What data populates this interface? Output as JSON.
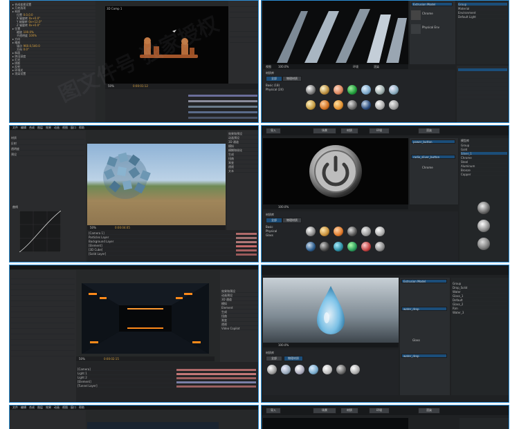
{
  "tiles": {
    "t1": {
      "title": "合成效果控件",
      "comp_label": "3D Comp 1",
      "tree": [
        "▸ 合成变换设置",
        "▸ 几何选项",
        "▸ 材质",
        "▸ 位置",
        "▸ 方向",
        "▸ 缩放",
        "▸ 斜面",
        "▸ 挤出深度",
        "▸ 灯光",
        "▸ 阴影",
        "▸ 反射",
        "▸ 环境光",
        "▸ 渲染设置"
      ],
      "props": [
        "位置",
        "X 轴旋转",
        "Y 轴旋转",
        "Z 轴旋转",
        "缩放",
        "不透明度",
        "锚点",
        "方向"
      ],
      "values": [
        "0.0,0.0",
        "0x+0.0°",
        "0x+12.0°",
        "0x+0.0°",
        "100.0%",
        "100%",
        "960.0,540.0",
        "0.0°"
      ],
      "zoom": "50%",
      "timecode": "0:00:01:12"
    },
    "t2": {
      "title": "Extrusion Model",
      "scene_items": [
        "Extrusion Model",
        "Chrome",
        "Physical Env"
      ],
      "right_items": [
        "Group",
        "Material",
        "Environment",
        "Default Light"
      ],
      "material_title": "材质库",
      "material_tabs": [
        "全部",
        "物理材质"
      ],
      "material_folders": [
        "Basic (18)",
        "Physical (24)"
      ],
      "bottom_labels": [
        "视图",
        "环境",
        "渲染"
      ],
      "zoom": "100.0%"
    },
    "t3": {
      "menu": [
        "文件",
        "编辑",
        "合成",
        "图层",
        "效果",
        "动画",
        "视图",
        "窗口",
        "帮助"
      ],
      "layers": [
        "[Camera 1]",
        "Particles Layer",
        "Background Layer",
        "[Element]",
        "[3D Cube]",
        "[Solid Layer]"
      ],
      "left_props": [
        "材质",
        "反射",
        "透明度",
        "预设",
        "曲线"
      ],
      "effects": [
        "效果和预设",
        "动画预设",
        "3D 通道",
        "模拟",
        "模糊和锐化",
        "生成",
        "扭曲",
        "渐变",
        "透视",
        "文本"
      ],
      "curves_title": "曲线",
      "timecode": "0:00:04:05",
      "zoom": "50%"
    },
    "t4": {
      "scene_items": [
        "power_button",
        "radio_sliver_button",
        "Chrome"
      ],
      "right_items": [
        "Group",
        "Gold",
        "Silver_1",
        "Chrome",
        "Steel",
        "Aluminum",
        "Bronze",
        "Copper"
      ],
      "top_buttons": [
        "导入",
        "场景",
        "材质",
        "环境",
        "渲染"
      ],
      "right_header": "模型库",
      "material_title": "材质库",
      "material_tabs": [
        "全部",
        "物理材质"
      ],
      "material_folders": [
        "Basic",
        "Physical",
        "Glass"
      ],
      "zoom": "100.0%"
    },
    "t5": {
      "effects": [
        "效果和预设",
        "动画预设",
        "3D 通道",
        "模拟",
        "Element",
        "生成",
        "扭曲",
        "渐变",
        "透视",
        "Video Copilot"
      ],
      "layers": [
        "[Camera]",
        "Light 1",
        "Light 2",
        "[Element]",
        "[Tunnel Layer]"
      ],
      "timecode": "0:00:02:15",
      "zoom": "50%"
    },
    "t6": {
      "scene_items": [
        "Extrusion Model",
        "water_drop",
        "Glass",
        "water_drop"
      ],
      "right_items": [
        "Group",
        "Drop_Solid",
        "Water",
        "Glass_1",
        "Default",
        "Glass_2",
        "Rim",
        "Water_3"
      ],
      "material_title": "材质库",
      "material_tabs": [
        "全部",
        "物理材质"
      ],
      "material_folders": [
        "Basic",
        "Glass"
      ],
      "zoom": "100.0%"
    },
    "t7": {
      "menu": [
        "文件",
        "编辑",
        "合成",
        "图层",
        "效果",
        "动画",
        "视图",
        "窗口",
        "帮助"
      ]
    },
    "t8": {
      "top_buttons": [
        "导入",
        "场景",
        "材质",
        "环境",
        "渲染"
      ]
    }
  },
  "watermark": "图文件号 独家授权",
  "colors": {
    "accent": "#2c8fd6",
    "ae_bg": "#262829",
    "e3d_bg": "#1f2123"
  }
}
